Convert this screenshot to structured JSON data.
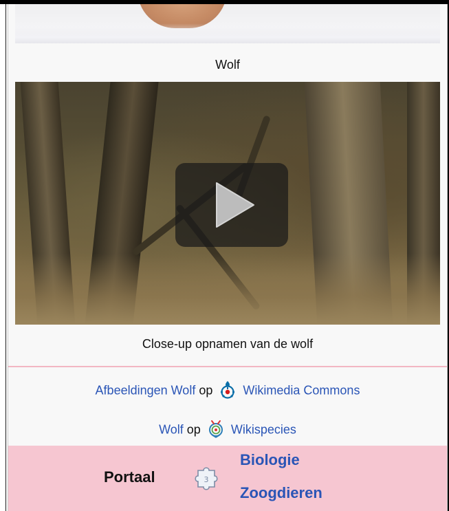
{
  "top_image": {
    "caption": "Wolf"
  },
  "video": {
    "caption": "Close-up opnamen van de wolf",
    "play_icon": "play-icon"
  },
  "commons": {
    "link_text": "Afbeeldingen Wolf",
    "connector": "op",
    "icon": "wikimedia-commons-icon",
    "site_text": "Wikimedia Commons"
  },
  "species": {
    "link_text": "Wolf",
    "connector": "op",
    "icon": "wikispecies-icon",
    "site_text": "Wikispecies"
  },
  "portal": {
    "label": "Portaal",
    "icon": "puzzle-piece-icon",
    "links": [
      "Biologie",
      "Zoogdieren"
    ]
  },
  "colors": {
    "link": "#2a55b6",
    "portal_background": "#f6c6d1",
    "divider": "#f2b6c3",
    "infobox_background": "#f8f8f8"
  }
}
